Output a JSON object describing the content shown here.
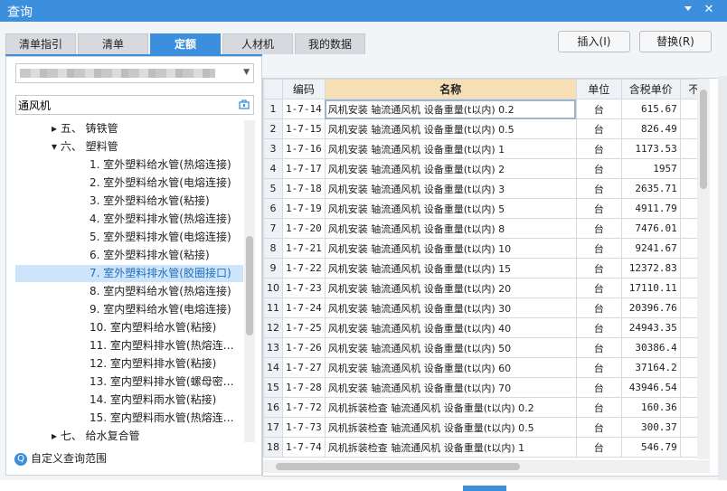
{
  "window": {
    "title": "查询",
    "pin_icon": "pin-icon",
    "close_icon": "close-icon"
  },
  "tabs": [
    {
      "label": "清单指引"
    },
    {
      "label": "清单"
    },
    {
      "label": "定额"
    },
    {
      "label": "人材机"
    },
    {
      "label": "我的数据"
    }
  ],
  "active_tab": "定额",
  "buttons": {
    "insert": "插入(I)",
    "replace": "替换(R)"
  },
  "search": {
    "value": "通风机"
  },
  "tree": [
    {
      "text": "▸ 五、 铸铁管"
    },
    {
      "text": "▾ 六、 塑料管"
    },
    {
      "text": "1. 室外塑料给水管(热熔连接)"
    },
    {
      "text": "2. 室外塑料给水管(电熔连接)"
    },
    {
      "text": "3. 室外塑料给水管(粘接)"
    },
    {
      "text": "4. 室外塑料排水管(热熔连接)"
    },
    {
      "text": "5. 室外塑料排水管(电熔连接)"
    },
    {
      "text": "6. 室外塑料排水管(粘接)"
    },
    {
      "text": "7. 室外塑料排水管(胶圈接口)"
    },
    {
      "text": "8. 室内塑料给水管(热熔连接)"
    },
    {
      "text": "9. 室内塑料给水管(电熔连接)"
    },
    {
      "text": "10. 室内塑料给水管(粘接)"
    },
    {
      "text": "11. 室内塑料排水管(热熔连…"
    },
    {
      "text": "12. 室内塑料排水管(粘接)"
    },
    {
      "text": "13. 室内塑料排水管(螺母密…"
    },
    {
      "text": "14. 室内塑料雨水管(粘接)"
    },
    {
      "text": "15. 室内塑料雨水管(热熔连…"
    },
    {
      "text": "▸ 七、 给水复合管"
    }
  ],
  "custom_query": {
    "label": "自定义查询范围",
    "icon": "search-circle-icon"
  },
  "table": {
    "headers": {
      "code": "编码",
      "name": "名称",
      "unit": "单位",
      "price": "含税单价",
      "extra": "不"
    },
    "rows": [
      {
        "n": "1",
        "code": "1-7-14",
        "name": "风机安装 轴流通风机 设备重量(t以内) 0.2",
        "unit": "台",
        "price": "615.67"
      },
      {
        "n": "2",
        "code": "1-7-15",
        "name": "风机安装 轴流通风机 设备重量(t以内) 0.5",
        "unit": "台",
        "price": "826.49"
      },
      {
        "n": "3",
        "code": "1-7-16",
        "name": "风机安装 轴流通风机 设备重量(t以内) 1",
        "unit": "台",
        "price": "1173.53"
      },
      {
        "n": "4",
        "code": "1-7-17",
        "name": "风机安装 轴流通风机 设备重量(t以内) 2",
        "unit": "台",
        "price": "1957"
      },
      {
        "n": "5",
        "code": "1-7-18",
        "name": "风机安装 轴流通风机 设备重量(t以内) 3",
        "unit": "台",
        "price": "2635.71"
      },
      {
        "n": "6",
        "code": "1-7-19",
        "name": "风机安装 轴流通风机 设备重量(t以内) 5",
        "unit": "台",
        "price": "4911.79"
      },
      {
        "n": "7",
        "code": "1-7-20",
        "name": "风机安装 轴流通风机 设备重量(t以内) 8",
        "unit": "台",
        "price": "7476.01"
      },
      {
        "n": "8",
        "code": "1-7-21",
        "name": "风机安装 轴流通风机 设备重量(t以内) 10",
        "unit": "台",
        "price": "9241.67"
      },
      {
        "n": "9",
        "code": "1-7-22",
        "name": "风机安装 轴流通风机 设备重量(t以内) 15",
        "unit": "台",
        "price": "12372.83"
      },
      {
        "n": "10",
        "code": "1-7-23",
        "name": "风机安装 轴流通风机 设备重量(t以内) 20",
        "unit": "台",
        "price": "17110.11"
      },
      {
        "n": "11",
        "code": "1-7-24",
        "name": "风机安装 轴流通风机 设备重量(t以内) 30",
        "unit": "台",
        "price": "20396.76"
      },
      {
        "n": "12",
        "code": "1-7-25",
        "name": "风机安装 轴流通风机 设备重量(t以内) 40",
        "unit": "台",
        "price": "24943.35"
      },
      {
        "n": "13",
        "code": "1-7-26",
        "name": "风机安装 轴流通风机 设备重量(t以内) 50",
        "unit": "台",
        "price": "30386.4"
      },
      {
        "n": "14",
        "code": "1-7-27",
        "name": "风机安装 轴流通风机 设备重量(t以内) 60",
        "unit": "台",
        "price": "37164.2"
      },
      {
        "n": "15",
        "code": "1-7-28",
        "name": "风机安装 轴流通风机 设备重量(t以内) 70",
        "unit": "台",
        "price": "43946.54"
      },
      {
        "n": "16",
        "code": "1-7-72",
        "name": "风机拆装检查 轴流通风机 设备重量(t以内) 0.2",
        "unit": "台",
        "price": "160.36"
      },
      {
        "n": "17",
        "code": "1-7-73",
        "name": "风机拆装检查 轴流通风机 设备重量(t以内) 0.5",
        "unit": "台",
        "price": "300.37"
      },
      {
        "n": "18",
        "code": "1-7-74",
        "name": "风机拆装检查 轴流通风机 设备重量(t以内) 1",
        "unit": "台",
        "price": "546.79"
      }
    ]
  },
  "colors": {
    "accent": "#3b8fdc",
    "header_highlight": "#f7dfb5",
    "selection": "#cde4fa"
  }
}
